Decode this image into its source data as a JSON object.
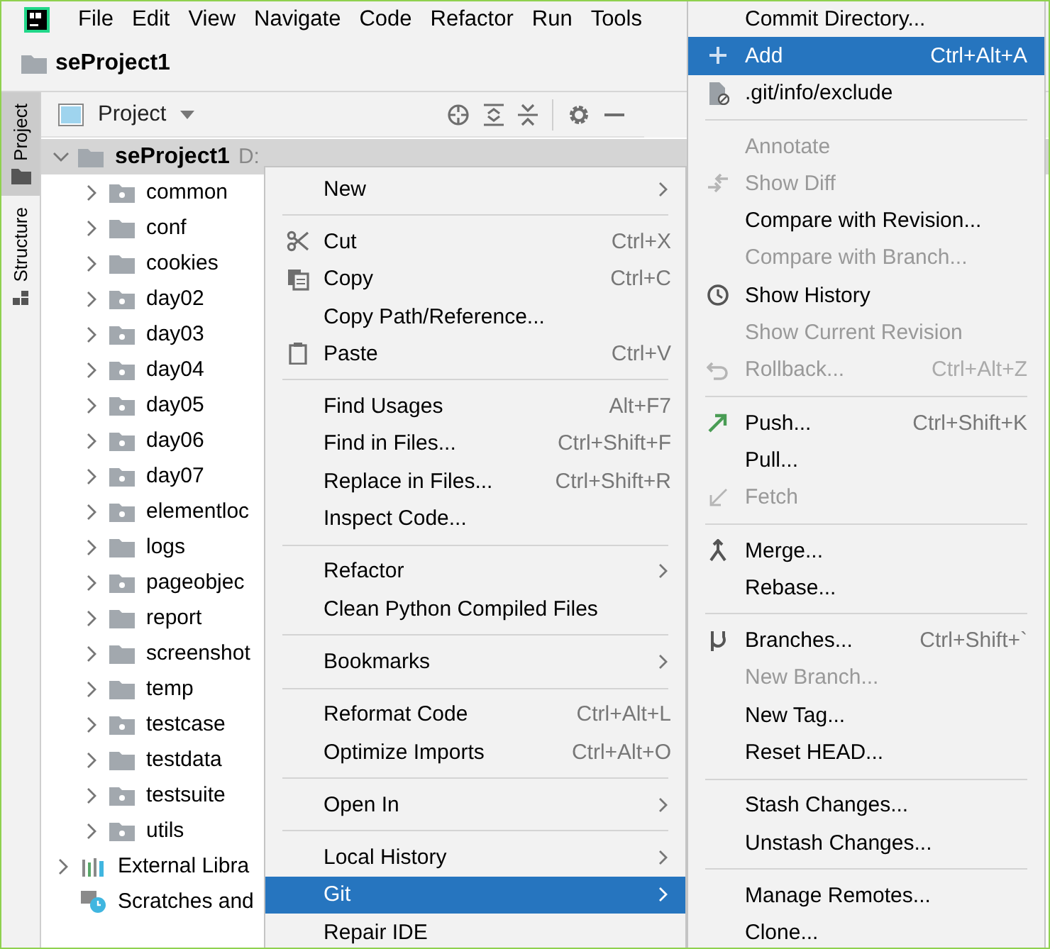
{
  "menu_bar": {
    "items": [
      "File",
      "Edit",
      "View",
      "Navigate",
      "Code",
      "Refactor",
      "Run",
      "Tools"
    ]
  },
  "breadcrumb": "seProject1",
  "tool_strip": [
    {
      "label": "Project",
      "selected": true
    },
    {
      "label": "Structure",
      "selected": false
    }
  ],
  "project_panel": {
    "view_label": "Project",
    "root": {
      "name": "seProject1",
      "path": "D:",
      "expanded": true,
      "selected": true
    },
    "items": [
      {
        "name": "common",
        "package": true,
        "expanded": false,
        "selected": false
      },
      {
        "name": "conf",
        "package": false,
        "expanded": false,
        "selected": false
      },
      {
        "name": "cookies",
        "package": false,
        "expanded": false,
        "selected": false
      },
      {
        "name": "day02",
        "package": true,
        "expanded": false,
        "selected": false
      },
      {
        "name": "day03",
        "package": true,
        "expanded": false,
        "selected": false
      },
      {
        "name": "day04",
        "package": true,
        "expanded": false,
        "selected": false
      },
      {
        "name": "day05",
        "package": true,
        "expanded": false,
        "selected": false
      },
      {
        "name": "day06",
        "package": true,
        "expanded": false,
        "selected": false
      },
      {
        "name": "day07",
        "package": true,
        "expanded": false,
        "selected": false
      },
      {
        "name": "elementloc",
        "package": true,
        "expanded": false,
        "selected": false
      },
      {
        "name": "logs",
        "package": false,
        "expanded": false,
        "selected": false
      },
      {
        "name": "pageobjec",
        "package": true,
        "expanded": false,
        "selected": false
      },
      {
        "name": "report",
        "package": false,
        "expanded": false,
        "selected": false
      },
      {
        "name": "screenshot",
        "package": false,
        "expanded": false,
        "selected": false
      },
      {
        "name": "temp",
        "package": false,
        "expanded": false,
        "selected": false
      },
      {
        "name": "testcase",
        "package": true,
        "expanded": false,
        "selected": false
      },
      {
        "name": "testdata",
        "package": false,
        "expanded": false,
        "selected": false
      },
      {
        "name": "testsuite",
        "package": true,
        "expanded": false,
        "selected": false
      },
      {
        "name": "utils",
        "package": true,
        "expanded": false,
        "selected": false
      }
    ],
    "extras": [
      {
        "kind": "libraries",
        "name": "External Libra",
        "expanded": false
      },
      {
        "kind": "scratches",
        "name": "Scratches and"
      }
    ]
  },
  "context_menu": [
    {
      "kind": "item",
      "label": "New",
      "submenu": true,
      "disabled": false,
      "selected": false
    },
    {
      "kind": "separator"
    },
    {
      "kind": "item",
      "label": "Cut",
      "shortcut": "Ctrl+X",
      "disabled": false,
      "selected": false
    },
    {
      "kind": "item",
      "label": "Copy",
      "shortcut": "Ctrl+C",
      "disabled": false,
      "selected": false
    },
    {
      "kind": "item",
      "label": "Copy Path/Reference...",
      "disabled": false,
      "selected": false
    },
    {
      "kind": "item",
      "label": "Paste",
      "shortcut": "Ctrl+V",
      "disabled": false,
      "selected": false
    },
    {
      "kind": "separator"
    },
    {
      "kind": "item",
      "label": "Find Usages",
      "shortcut": "Alt+F7",
      "disabled": false,
      "selected": false
    },
    {
      "kind": "item",
      "label": "Find in Files...",
      "shortcut": "Ctrl+Shift+F",
      "disabled": false,
      "selected": false
    },
    {
      "kind": "item",
      "label": "Replace in Files...",
      "shortcut": "Ctrl+Shift+R",
      "disabled": false,
      "selected": false
    },
    {
      "kind": "item",
      "label": "Inspect Code...",
      "disabled": false,
      "selected": false
    },
    {
      "kind": "separator"
    },
    {
      "kind": "item",
      "label": "Refactor",
      "submenu": true,
      "disabled": false,
      "selected": false
    },
    {
      "kind": "item",
      "label": "Clean Python Compiled Files",
      "disabled": false,
      "selected": false
    },
    {
      "kind": "separator"
    },
    {
      "kind": "item",
      "label": "Bookmarks",
      "submenu": true,
      "disabled": false,
      "selected": false
    },
    {
      "kind": "separator"
    },
    {
      "kind": "item",
      "label": "Reformat Code",
      "shortcut": "Ctrl+Alt+L",
      "disabled": false,
      "selected": false
    },
    {
      "kind": "item",
      "label": "Optimize Imports",
      "shortcut": "Ctrl+Alt+O",
      "disabled": false,
      "selected": false
    },
    {
      "kind": "separator"
    },
    {
      "kind": "item",
      "label": "Open In",
      "submenu": true,
      "disabled": false,
      "selected": false
    },
    {
      "kind": "separator"
    },
    {
      "kind": "item",
      "label": "Local History",
      "submenu": true,
      "disabled": false,
      "selected": false
    },
    {
      "kind": "item",
      "label": "Git",
      "submenu": true,
      "disabled": false,
      "selected": true
    },
    {
      "kind": "item",
      "label": "Repair IDE",
      "disabled": false,
      "selected": false
    }
  ],
  "git_menu": [
    {
      "kind": "item",
      "label": "Commit Directory...",
      "disabled": false,
      "selected": false
    },
    {
      "kind": "item",
      "label": "Add",
      "shortcut": "Ctrl+Alt+A",
      "disabled": false,
      "selected": true
    },
    {
      "kind": "item",
      "label": ".git/info/exclude",
      "disabled": false,
      "selected": false
    },
    {
      "kind": "separator"
    },
    {
      "kind": "item",
      "label": "Annotate",
      "disabled": true,
      "selected": false
    },
    {
      "kind": "item",
      "label": "Show Diff",
      "disabled": true,
      "selected": false
    },
    {
      "kind": "item",
      "label": "Compare with Revision...",
      "disabled": false,
      "selected": false
    },
    {
      "kind": "item",
      "label": "Compare with Branch...",
      "disabled": true,
      "selected": false
    },
    {
      "kind": "item",
      "label": "Show History",
      "disabled": false,
      "selected": false
    },
    {
      "kind": "item",
      "label": "Show Current Revision",
      "disabled": true,
      "selected": false
    },
    {
      "kind": "item",
      "label": "Rollback...",
      "shortcut": "Ctrl+Alt+Z",
      "disabled": true,
      "selected": false
    },
    {
      "kind": "separator"
    },
    {
      "kind": "item",
      "label": "Push...",
      "shortcut": "Ctrl+Shift+K",
      "disabled": false,
      "selected": false
    },
    {
      "kind": "item",
      "label": "Pull...",
      "disabled": false,
      "selected": false
    },
    {
      "kind": "item",
      "label": "Fetch",
      "disabled": true,
      "selected": false
    },
    {
      "kind": "separator"
    },
    {
      "kind": "item",
      "label": "Merge...",
      "disabled": false,
      "selected": false
    },
    {
      "kind": "item",
      "label": "Rebase...",
      "disabled": false,
      "selected": false
    },
    {
      "kind": "separator"
    },
    {
      "kind": "item",
      "label": "Branches...",
      "shortcut": "Ctrl+Shift+`",
      "disabled": false,
      "selected": false
    },
    {
      "kind": "item",
      "label": "New Branch...",
      "disabled": true,
      "selected": false
    },
    {
      "kind": "item",
      "label": "New Tag...",
      "disabled": false,
      "selected": false
    },
    {
      "kind": "item",
      "label": "Reset HEAD...",
      "disabled": false,
      "selected": false
    },
    {
      "kind": "separator"
    },
    {
      "kind": "item",
      "label": "Stash Changes...",
      "disabled": false,
      "selected": false
    },
    {
      "kind": "item",
      "label": "Unstash Changes...",
      "disabled": false,
      "selected": false
    },
    {
      "kind": "separator"
    },
    {
      "kind": "item",
      "label": "Manage Remotes...",
      "disabled": false,
      "selected": false
    },
    {
      "kind": "item",
      "label": "Clone...",
      "disabled": false,
      "selected": false
    }
  ]
}
